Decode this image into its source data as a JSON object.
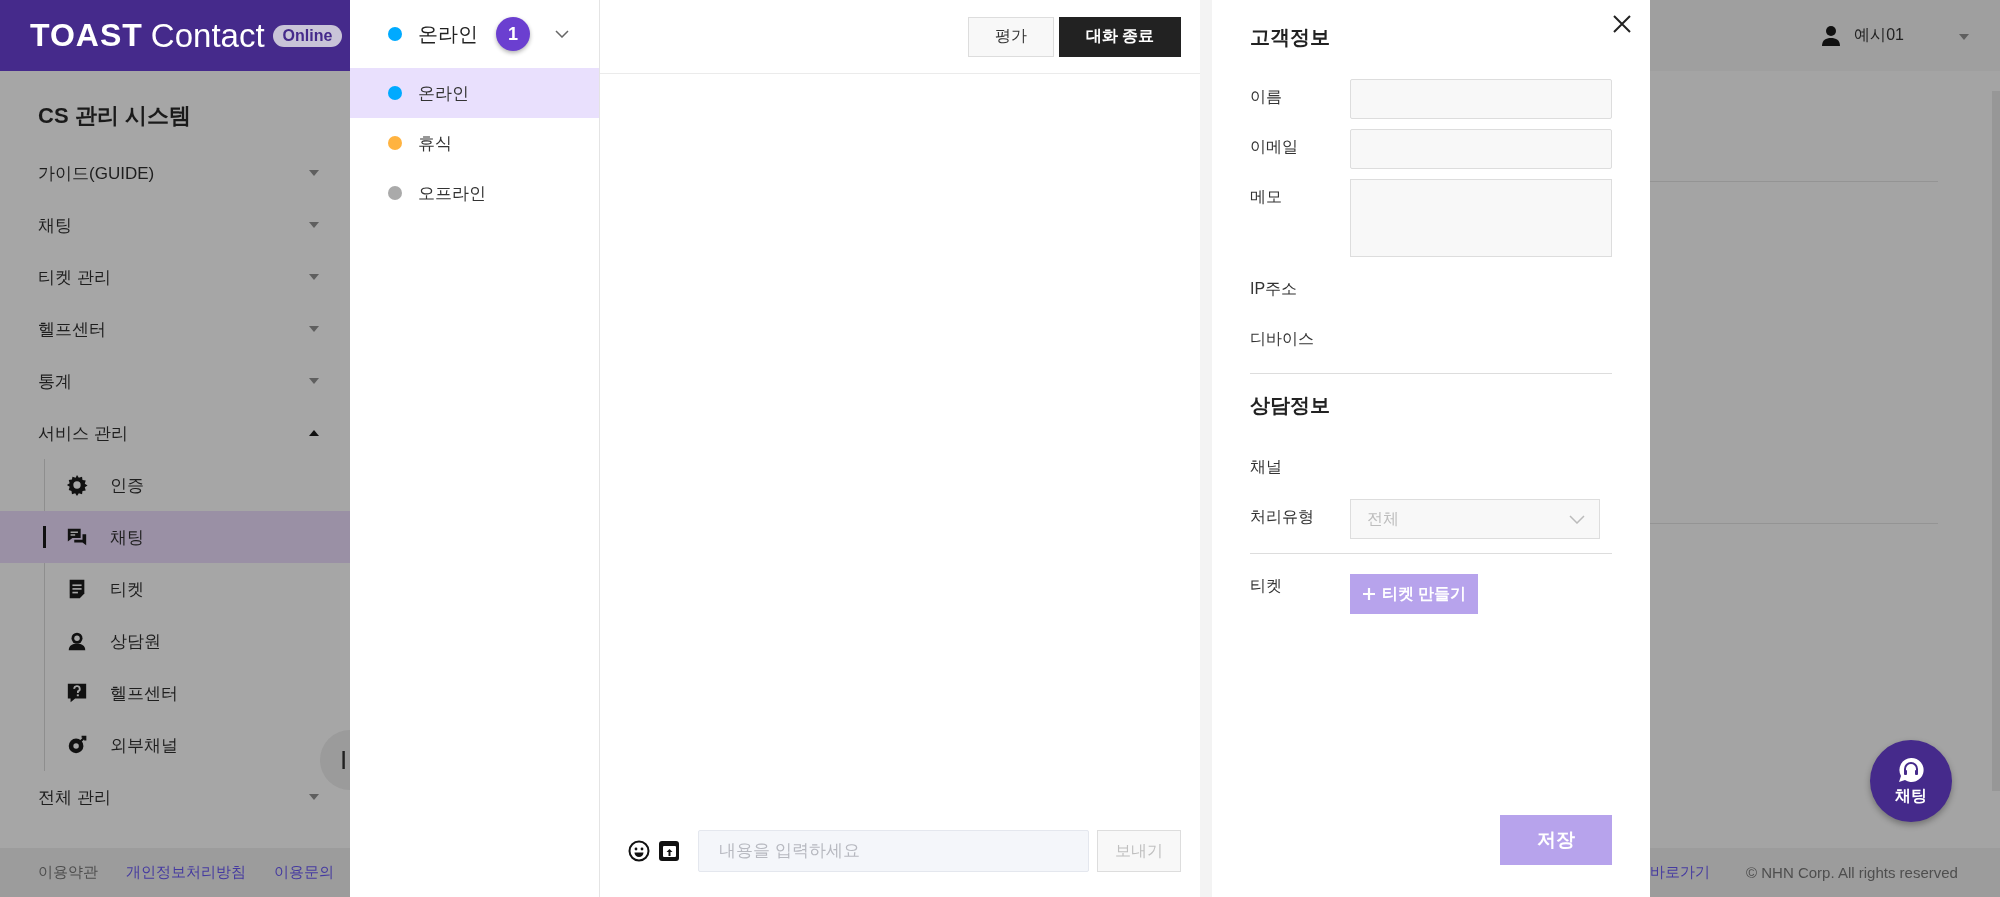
{
  "app_header": {
    "logo": "TOAST",
    "product": "Contact",
    "edition": "Online",
    "user": "예시01"
  },
  "sidebar": {
    "title": "CS 관리 시스템",
    "items": [
      {
        "label": "가이드(GUIDE)",
        "expanded": false
      },
      {
        "label": "채팅",
        "expanded": false
      },
      {
        "label": "티켓 관리",
        "expanded": false
      },
      {
        "label": "헬프센터",
        "expanded": false
      },
      {
        "label": "통계",
        "expanded": false
      },
      {
        "label": "서비스 관리",
        "expanded": true,
        "children": [
          {
            "label": "인증",
            "selected": false
          },
          {
            "label": "채팅",
            "selected": true
          },
          {
            "label": "티켓",
            "selected": false
          },
          {
            "label": "상담원",
            "selected": false
          },
          {
            "label": "헬프센터",
            "selected": false
          },
          {
            "label": "외부채널",
            "selected": false
          }
        ]
      },
      {
        "label": "전체 관리",
        "expanded": false
      }
    ]
  },
  "side_handle": "I",
  "footer_left": [
    {
      "label": "이용약관",
      "kind": "plain"
    },
    {
      "label": "개인정보처리방침",
      "kind": "link"
    },
    {
      "label": "이용문의",
      "kind": "link"
    }
  ],
  "footer_right": {
    "link": "바로가기",
    "copyright": "© NHN Corp. All rights reserved"
  },
  "status_menu": {
    "current": {
      "label": "온라인",
      "color": "#00aaff"
    },
    "badge": "1",
    "expanded": true,
    "options": [
      {
        "label": "온라인",
        "color": "#00aaff",
        "selected": true
      },
      {
        "label": "휴식",
        "color": "#ffb340",
        "selected": false
      },
      {
        "label": "오프라인",
        "color": "#aaaaaa",
        "selected": false
      }
    ]
  },
  "chat": {
    "buttons": [
      {
        "label": "평가",
        "kind": "secondary"
      },
      {
        "label": "대화 종료",
        "kind": "primary"
      }
    ],
    "input": {
      "placeholder": "내용을 입력하세요"
    },
    "send": {
      "label": "보내기",
      "disabled": true
    }
  },
  "customer_panel": {
    "title": "고객정보",
    "fields": [
      {
        "label": "이름",
        "kind": "input"
      },
      {
        "label": "이메일",
        "kind": "input"
      },
      {
        "label": "메모",
        "kind": "textarea"
      },
      {
        "label": "IP주소",
        "kind": "text"
      },
      {
        "label": "디바이스",
        "kind": "text"
      }
    ],
    "consult_title": "상담정보",
    "consult_fields": [
      {
        "label": "채널",
        "kind": "text"
      },
      {
        "label": "처리유형",
        "kind": "select",
        "value": "전체"
      }
    ],
    "ticket": {
      "label": "티켓",
      "button": "티켓 만들기",
      "disabled": true
    },
    "save": {
      "label": "저장",
      "disabled": true
    }
  },
  "chat_fab": {
    "label": "채팅"
  }
}
